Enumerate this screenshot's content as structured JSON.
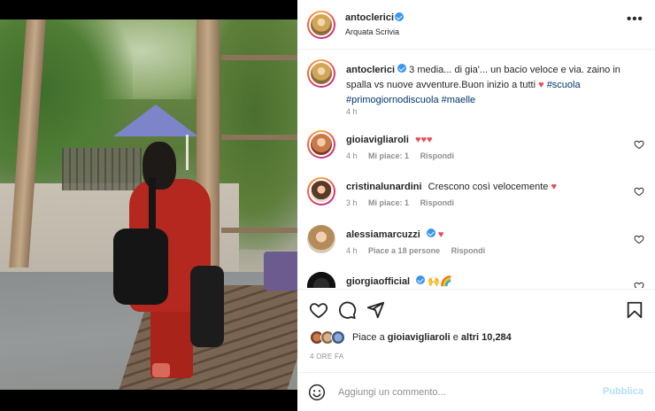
{
  "header": {
    "username": "antoclerici",
    "location": "Arquata Scrivia",
    "more_label": "•••"
  },
  "caption": {
    "username": "antoclerici",
    "text": "3 media... di gia'... un bacio veloce e via. zaino in spalla vs nuove avventure.Buon inizio a tutti",
    "heart": "♥",
    "hashtags": [
      "#scuola",
      "#primogiornodiscuola",
      "#maelle"
    ],
    "time": "4 h"
  },
  "comments": [
    {
      "username": "gioiavigliaroli",
      "text": "♥♥♥",
      "time": "4 h",
      "likes": "Mi piace: 1",
      "reply": "Rispondi"
    },
    {
      "username": "cristinalunardini",
      "text": "Crescono così velocemente",
      "heart": "♥",
      "time": "3 h",
      "likes": "Mi piace: 1",
      "reply": "Rispondi"
    },
    {
      "username": "alessiamarcuzzi",
      "text": "♥",
      "time": "4 h",
      "likes": "Piace a 18 persone",
      "reply": "Rispondi"
    },
    {
      "username": "giorgiaofficial",
      "text": "🙌🌈"
    }
  ],
  "likes": {
    "prefix": "Piace a",
    "user": "gioiavigliaroli",
    "middle": "e",
    "others": "altri 10,284"
  },
  "post_time": "4 ORE FA",
  "add_comment": {
    "placeholder": "Aggiungi un commento...",
    "publish_label": "Pubblica"
  },
  "colors": {
    "accent": "#3897f0",
    "heart": "#ed4956",
    "publish_disabled": "#b2dffc",
    "hashtag": "#00376b"
  }
}
